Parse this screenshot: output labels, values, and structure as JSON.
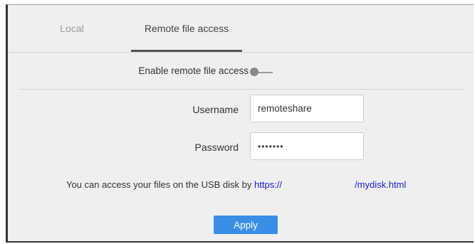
{
  "tabs": [
    {
      "label": "Local",
      "active": false
    },
    {
      "label": "Remote file access",
      "active": true
    }
  ],
  "remote_access": {
    "enable_label": "Enable remote file access",
    "enabled": false
  },
  "form": {
    "username_label": "Username",
    "username_value": "remoteshare",
    "password_label": "Password",
    "password_value": "•••••••"
  },
  "info": {
    "prefix": "You can access your files on the USB disk by",
    "link_start": "https://",
    "link_end": "/mydisk.html"
  },
  "apply_label": "Apply",
  "colors": {
    "accent": "#3a8ee6",
    "link": "#1a1ad6",
    "panel_background": "#efefef"
  }
}
